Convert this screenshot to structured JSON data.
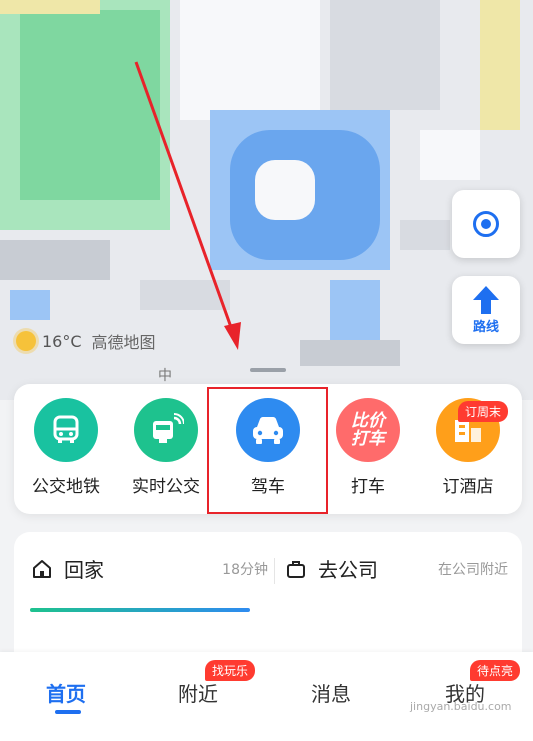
{
  "map": {
    "temperature": "16°C",
    "brand": "高德地图",
    "route_label": "路线",
    "street_char": "中"
  },
  "features": [
    {
      "id": "bus",
      "label": "公交地铁",
      "icon": "bus-icon"
    },
    {
      "id": "realtime",
      "label": "实时公交",
      "icon": "realtime-bus-icon"
    },
    {
      "id": "drive",
      "label": "驾车",
      "icon": "car-icon"
    },
    {
      "id": "taxi",
      "label": "打车",
      "icon": "taxi-icon",
      "icon_text": "比价打车"
    },
    {
      "id": "hotel",
      "label": "订酒店",
      "icon": "hotel-icon",
      "badge": "订周末"
    }
  ],
  "commute": {
    "home": {
      "title": "回家",
      "sub": "18分钟"
    },
    "work": {
      "title": "去公司",
      "sub": "在公司附近"
    }
  },
  "nav": {
    "home": "首页",
    "nearby": "附近",
    "nearby_badge": "找玩乐",
    "messages": "消息",
    "mine": "我的",
    "mine_badge": "待点亮"
  },
  "watermark": "jingyan.baidu.com",
  "colors": {
    "accent": "#1e6ff0",
    "highlight": "#e8232a",
    "badge": "#ff3b30"
  }
}
